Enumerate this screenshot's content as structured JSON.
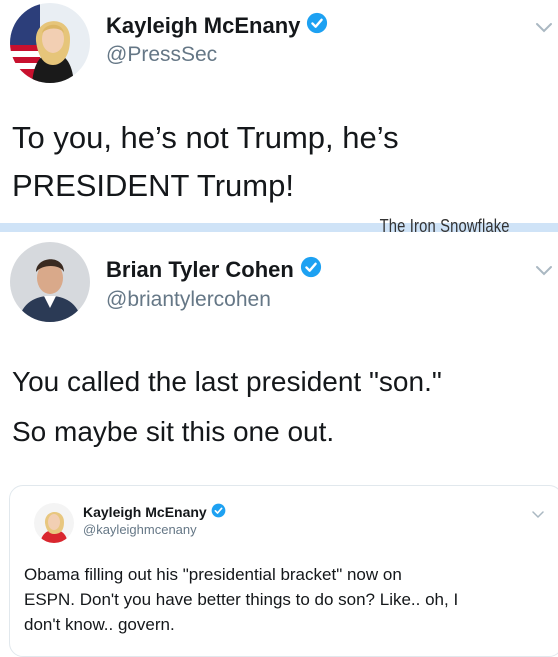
{
  "tweets": [
    {
      "name": "Kayleigh McEnany",
      "handle": "@PressSec",
      "text_lines": [
        "To you, he’s not Trump, he’s",
        "PRESIDENT Trump!"
      ],
      "verified": true
    },
    {
      "name": "Brian Tyler Cohen",
      "handle": "@briantylercohen",
      "text_lines": [
        "You called the last president \"son.\"",
        "So maybe sit this one out."
      ],
      "verified": true
    }
  ],
  "quoted_tweet": {
    "name": "Kayleigh McEnany",
    "handle": "@kayleighmcenany",
    "text_lines": [
      "Obama filling out his \"presidential bracket\" now on",
      "ESPN.  Don't you have better things to do son? Like.. oh, I",
      "don't know.. govern."
    ],
    "verified": true
  },
  "watermark": "The Iron Snowflake",
  "colors": {
    "verified_badge": "#1da1f2",
    "handle_text": "#657786",
    "divider": "#cfe3f7"
  },
  "icons": {
    "verified": "verified-badge-icon",
    "more": "chevron-down-icon"
  }
}
